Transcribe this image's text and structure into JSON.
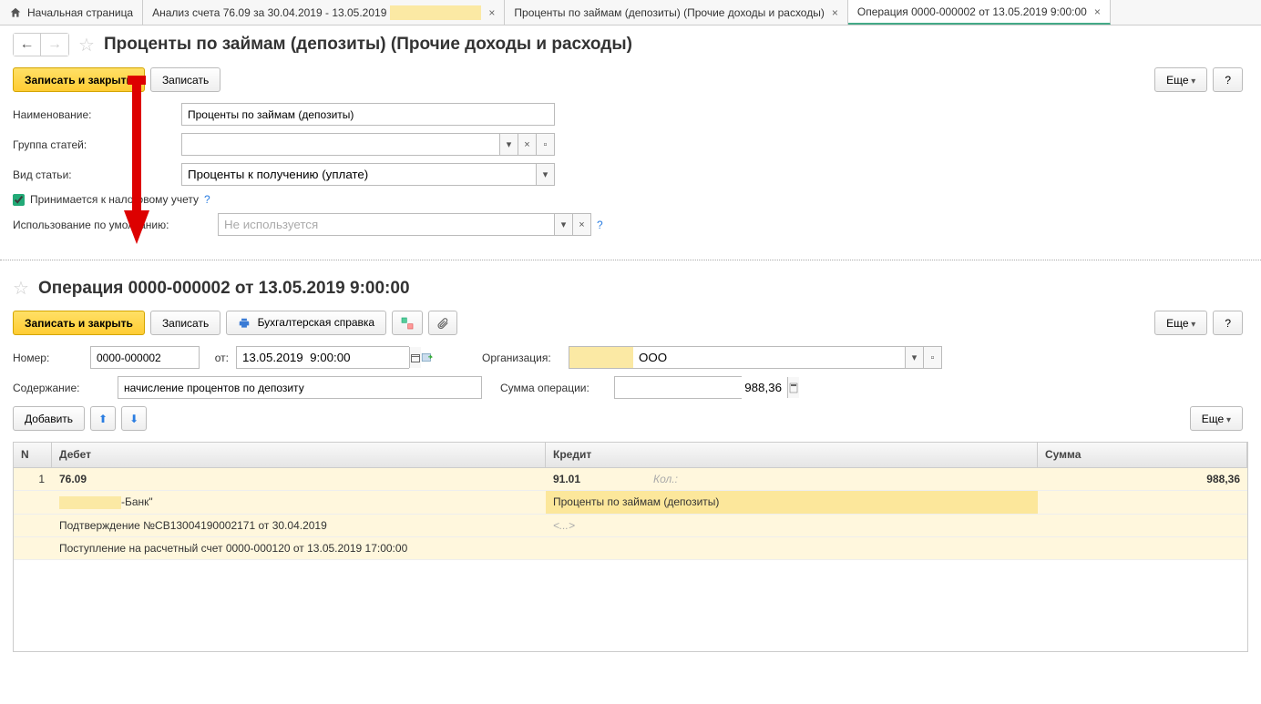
{
  "tabs": {
    "home": "Начальная страница",
    "analysis": "Анализ счета 76.09 за 30.04.2019 - 13.05.2019",
    "interest": "Проценты по займам (депозиты) (Прочие доходы и расходы)",
    "operation": "Операция 0000-000002 от 13.05.2019 9:00:00"
  },
  "section1": {
    "title": "Проценты по займам (депозиты) (Прочие доходы и расходы)",
    "write_close": "Записать и закрыть",
    "write": "Записать",
    "more": "Еще",
    "help": "?",
    "labels": {
      "name": "Наименование:",
      "group": "Группа статей:",
      "kind": "Вид статьи:",
      "tax": "Принимается к налоговому учету",
      "default_use": "Использование по умолчанию:"
    },
    "values": {
      "name": "Проценты по займам (депозиты)",
      "group": "",
      "kind": "Проценты к получению (уплате)",
      "default_use": "Не используется"
    }
  },
  "section2": {
    "title": "Операция 0000-000002 от 13.05.2019 9:00:00",
    "write_close": "Записать и закрыть",
    "write": "Записать",
    "accounting_ref": "Бухгалтерская справка",
    "more": "Еще",
    "help": "?",
    "labels": {
      "number": "Номер:",
      "from": "от:",
      "org": "Организация:",
      "content": "Содержание:",
      "op_sum": "Сумма операции:"
    },
    "values": {
      "number": "0000-000002",
      "date": "13.05.2019  9:00:00",
      "org": "ООО",
      "content": "начисление процентов по депозиту",
      "op_sum": "988,36"
    },
    "add_btn": "Добавить"
  },
  "grid": {
    "headers": {
      "n": "N",
      "debit": "Дебет",
      "credit": "Кредит",
      "sum": "Сумма"
    },
    "row": {
      "n": "1",
      "debit_acct": "76.09",
      "credit_acct": "91.01",
      "qty_label": "Кол.:",
      "sum": "988,36",
      "debit_line2": "-Банк\"",
      "credit_line2": "Проценты по займам (депозиты)",
      "debit_line3": "Подтверждение №СВ13004190002171 от 30.04.2019",
      "credit_line3": "<...>",
      "debit_line4": "Поступление на расчетный счет 0000-000120 от 13.05.2019 17:00:00"
    }
  }
}
